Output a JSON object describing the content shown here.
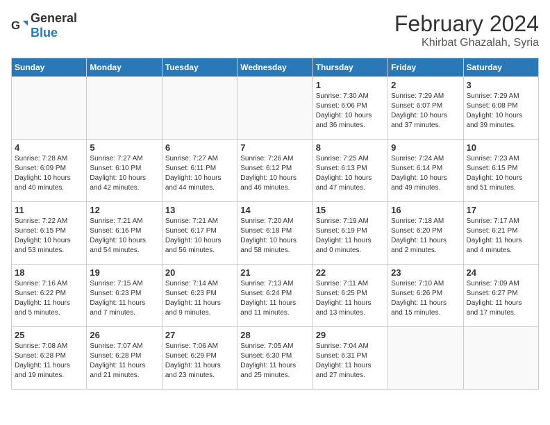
{
  "header": {
    "logo_general": "General",
    "logo_blue": "Blue",
    "main_title": "February 2024",
    "subtitle": "Khirbat Ghazalah, Syria"
  },
  "weekdays": [
    "Sunday",
    "Monday",
    "Tuesday",
    "Wednesday",
    "Thursday",
    "Friday",
    "Saturday"
  ],
  "weeks": [
    [
      {
        "day": "",
        "info": ""
      },
      {
        "day": "",
        "info": ""
      },
      {
        "day": "",
        "info": ""
      },
      {
        "day": "",
        "info": ""
      },
      {
        "day": "1",
        "info": "Sunrise: 7:30 AM\nSunset: 6:06 PM\nDaylight: 10 hours\nand 36 minutes."
      },
      {
        "day": "2",
        "info": "Sunrise: 7:29 AM\nSunset: 6:07 PM\nDaylight: 10 hours\nand 37 minutes."
      },
      {
        "day": "3",
        "info": "Sunrise: 7:29 AM\nSunset: 6:08 PM\nDaylight: 10 hours\nand 39 minutes."
      }
    ],
    [
      {
        "day": "4",
        "info": "Sunrise: 7:28 AM\nSunset: 6:09 PM\nDaylight: 10 hours\nand 40 minutes."
      },
      {
        "day": "5",
        "info": "Sunrise: 7:27 AM\nSunset: 6:10 PM\nDaylight: 10 hours\nand 42 minutes."
      },
      {
        "day": "6",
        "info": "Sunrise: 7:27 AM\nSunset: 6:11 PM\nDaylight: 10 hours\nand 44 minutes."
      },
      {
        "day": "7",
        "info": "Sunrise: 7:26 AM\nSunset: 6:12 PM\nDaylight: 10 hours\nand 46 minutes."
      },
      {
        "day": "8",
        "info": "Sunrise: 7:25 AM\nSunset: 6:13 PM\nDaylight: 10 hours\nand 47 minutes."
      },
      {
        "day": "9",
        "info": "Sunrise: 7:24 AM\nSunset: 6:14 PM\nDaylight: 10 hours\nand 49 minutes."
      },
      {
        "day": "10",
        "info": "Sunrise: 7:23 AM\nSunset: 6:15 PM\nDaylight: 10 hours\nand 51 minutes."
      }
    ],
    [
      {
        "day": "11",
        "info": "Sunrise: 7:22 AM\nSunset: 6:15 PM\nDaylight: 10 hours\nand 53 minutes."
      },
      {
        "day": "12",
        "info": "Sunrise: 7:21 AM\nSunset: 6:16 PM\nDaylight: 10 hours\nand 54 minutes."
      },
      {
        "day": "13",
        "info": "Sunrise: 7:21 AM\nSunset: 6:17 PM\nDaylight: 10 hours\nand 56 minutes."
      },
      {
        "day": "14",
        "info": "Sunrise: 7:20 AM\nSunset: 6:18 PM\nDaylight: 10 hours\nand 58 minutes."
      },
      {
        "day": "15",
        "info": "Sunrise: 7:19 AM\nSunset: 6:19 PM\nDaylight: 11 hours\nand 0 minutes."
      },
      {
        "day": "16",
        "info": "Sunrise: 7:18 AM\nSunset: 6:20 PM\nDaylight: 11 hours\nand 2 minutes."
      },
      {
        "day": "17",
        "info": "Sunrise: 7:17 AM\nSunset: 6:21 PM\nDaylight: 11 hours\nand 4 minutes."
      }
    ],
    [
      {
        "day": "18",
        "info": "Sunrise: 7:16 AM\nSunset: 6:22 PM\nDaylight: 11 hours\nand 5 minutes."
      },
      {
        "day": "19",
        "info": "Sunrise: 7:15 AM\nSunset: 6:23 PM\nDaylight: 11 hours\nand 7 minutes."
      },
      {
        "day": "20",
        "info": "Sunrise: 7:14 AM\nSunset: 6:23 PM\nDaylight: 11 hours\nand 9 minutes."
      },
      {
        "day": "21",
        "info": "Sunrise: 7:13 AM\nSunset: 6:24 PM\nDaylight: 11 hours\nand 11 minutes."
      },
      {
        "day": "22",
        "info": "Sunrise: 7:11 AM\nSunset: 6:25 PM\nDaylight: 11 hours\nand 13 minutes."
      },
      {
        "day": "23",
        "info": "Sunrise: 7:10 AM\nSunset: 6:26 PM\nDaylight: 11 hours\nand 15 minutes."
      },
      {
        "day": "24",
        "info": "Sunrise: 7:09 AM\nSunset: 6:27 PM\nDaylight: 11 hours\nand 17 minutes."
      }
    ],
    [
      {
        "day": "25",
        "info": "Sunrise: 7:08 AM\nSunset: 6:28 PM\nDaylight: 11 hours\nand 19 minutes."
      },
      {
        "day": "26",
        "info": "Sunrise: 7:07 AM\nSunset: 6:28 PM\nDaylight: 11 hours\nand 21 minutes."
      },
      {
        "day": "27",
        "info": "Sunrise: 7:06 AM\nSunset: 6:29 PM\nDaylight: 11 hours\nand 23 minutes."
      },
      {
        "day": "28",
        "info": "Sunrise: 7:05 AM\nSunset: 6:30 PM\nDaylight: 11 hours\nand 25 minutes."
      },
      {
        "day": "29",
        "info": "Sunrise: 7:04 AM\nSunset: 6:31 PM\nDaylight: 11 hours\nand 27 minutes."
      },
      {
        "day": "",
        "info": ""
      },
      {
        "day": "",
        "info": ""
      }
    ]
  ]
}
